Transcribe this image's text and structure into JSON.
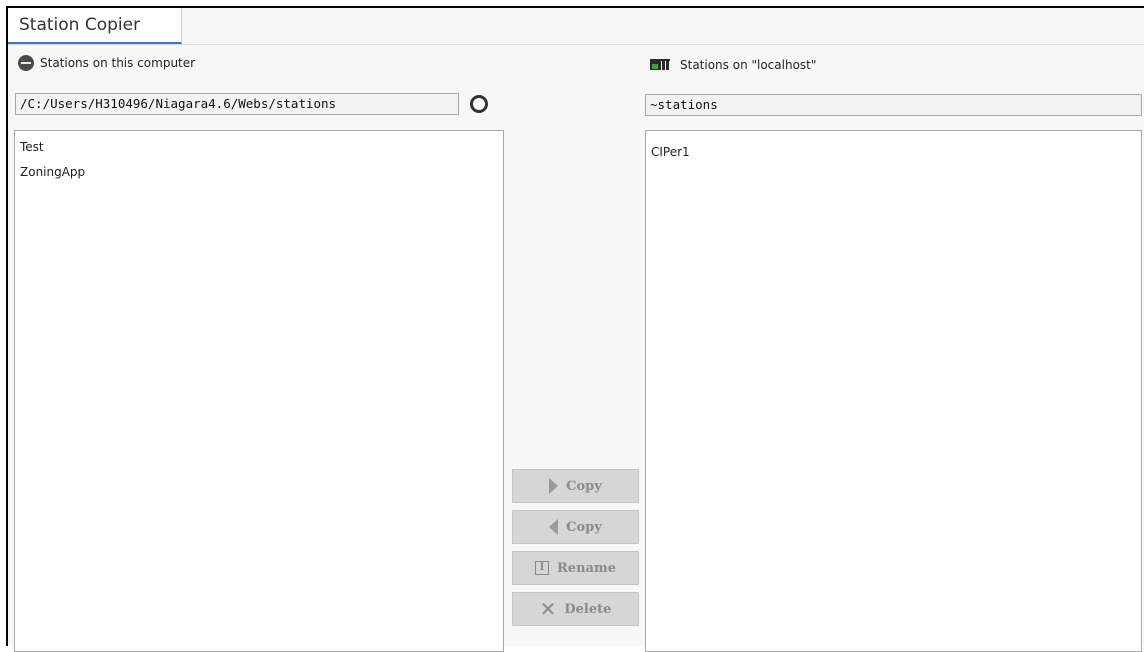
{
  "tab": {
    "title": "Station Copier"
  },
  "left": {
    "header": "Stations on this computer",
    "path": "/C:/Users/H310496/Niagara4.6/Webs/stations",
    "items": [
      "Test",
      "ZoningApp"
    ]
  },
  "right": {
    "header": "Stations on \"localhost\"",
    "path": "~stations",
    "items": [
      "CIPer1"
    ]
  },
  "actions": {
    "copy_right": "Copy",
    "copy_left": "Copy",
    "rename": "Rename",
    "delete": "Delete",
    "rename_glyph": "I",
    "delete_glyph": "✕"
  },
  "colors": {
    "tab_underline": "#3d73c4",
    "disabled_button": "#d6d6d6",
    "station_icon_green": "#3fa33b"
  },
  "icons": {
    "left_header": "hard-drive-icon",
    "right_header": "station-icon",
    "browse": "browse-icon",
    "copy_right": "arrow-right-icon",
    "copy_left": "arrow-left-icon",
    "rename": "rename-icon",
    "delete": "delete-icon"
  }
}
